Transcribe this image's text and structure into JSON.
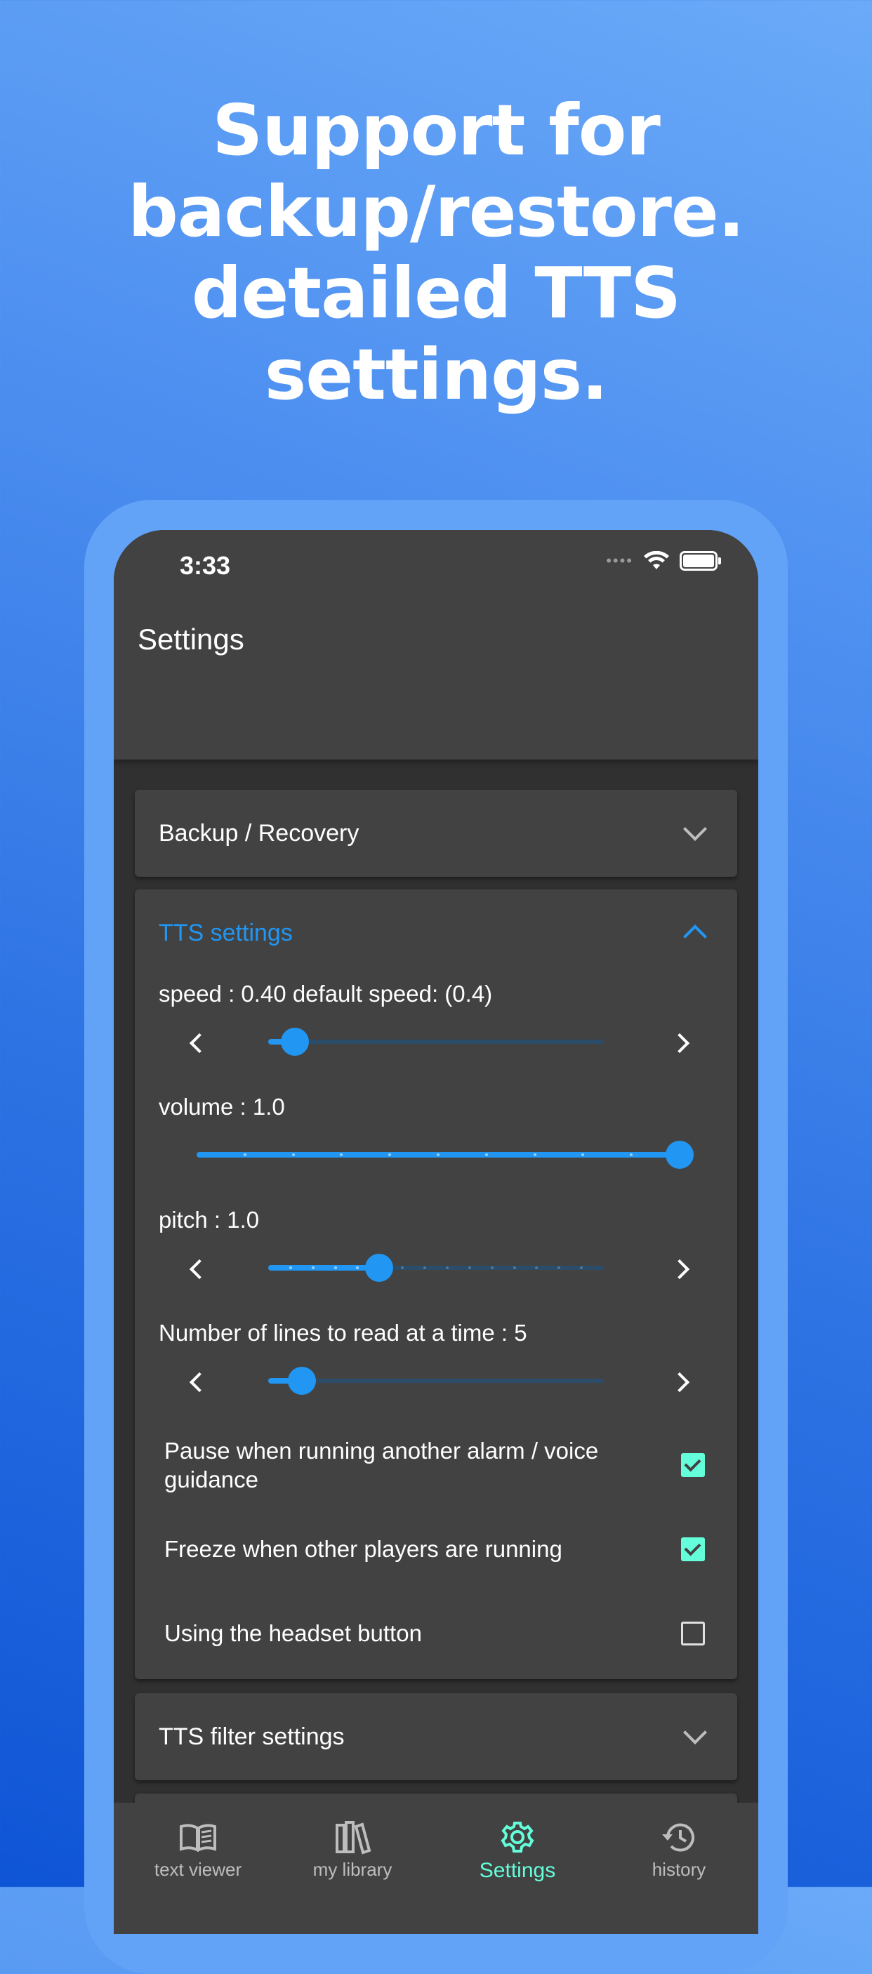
{
  "headline": [
    "Support for",
    "backup/restore.",
    "detailed TTS",
    "settings."
  ],
  "status_bar": {
    "time": "3:33"
  },
  "app_bar": {
    "title": "Settings"
  },
  "panels": {
    "backup": {
      "title": "Backup / Recovery",
      "expanded": false
    },
    "tts": {
      "title": "TTS settings",
      "expanded": true,
      "speed": {
        "label": "speed : 0.40   default speed: (0.4)",
        "value": 0.4,
        "fraction": 0.08
      },
      "volume": {
        "label": "volume : 1.0",
        "value": 1.0,
        "fraction": 1.0
      },
      "pitch": {
        "label": "pitch : 1.0",
        "value": 1.0,
        "fraction": 0.33
      },
      "lines": {
        "label": "Number of lines to read at a time  : 5",
        "value": 5,
        "fraction": 0.1
      },
      "options": [
        {
          "label": "Pause when running another alarm / voice guidance",
          "checked": true
        },
        {
          "label": "Freeze when other players are running",
          "checked": true
        },
        {
          "label": "Using the headset button",
          "checked": false
        }
      ]
    },
    "filter": {
      "title": "TTS filter settings",
      "expanded": false
    }
  },
  "bottom_nav": [
    {
      "label": "text viewer",
      "icon": "book-icon",
      "active": false
    },
    {
      "label": "my library",
      "icon": "library-icon",
      "active": false
    },
    {
      "label": "Settings",
      "icon": "gear-icon",
      "active": true
    },
    {
      "label": "history",
      "icon": "history-icon",
      "active": false
    }
  ],
  "colors": {
    "accent": "#2196f3",
    "active_nav": "#64ffda",
    "panel": "#424242",
    "background": "#303030"
  }
}
